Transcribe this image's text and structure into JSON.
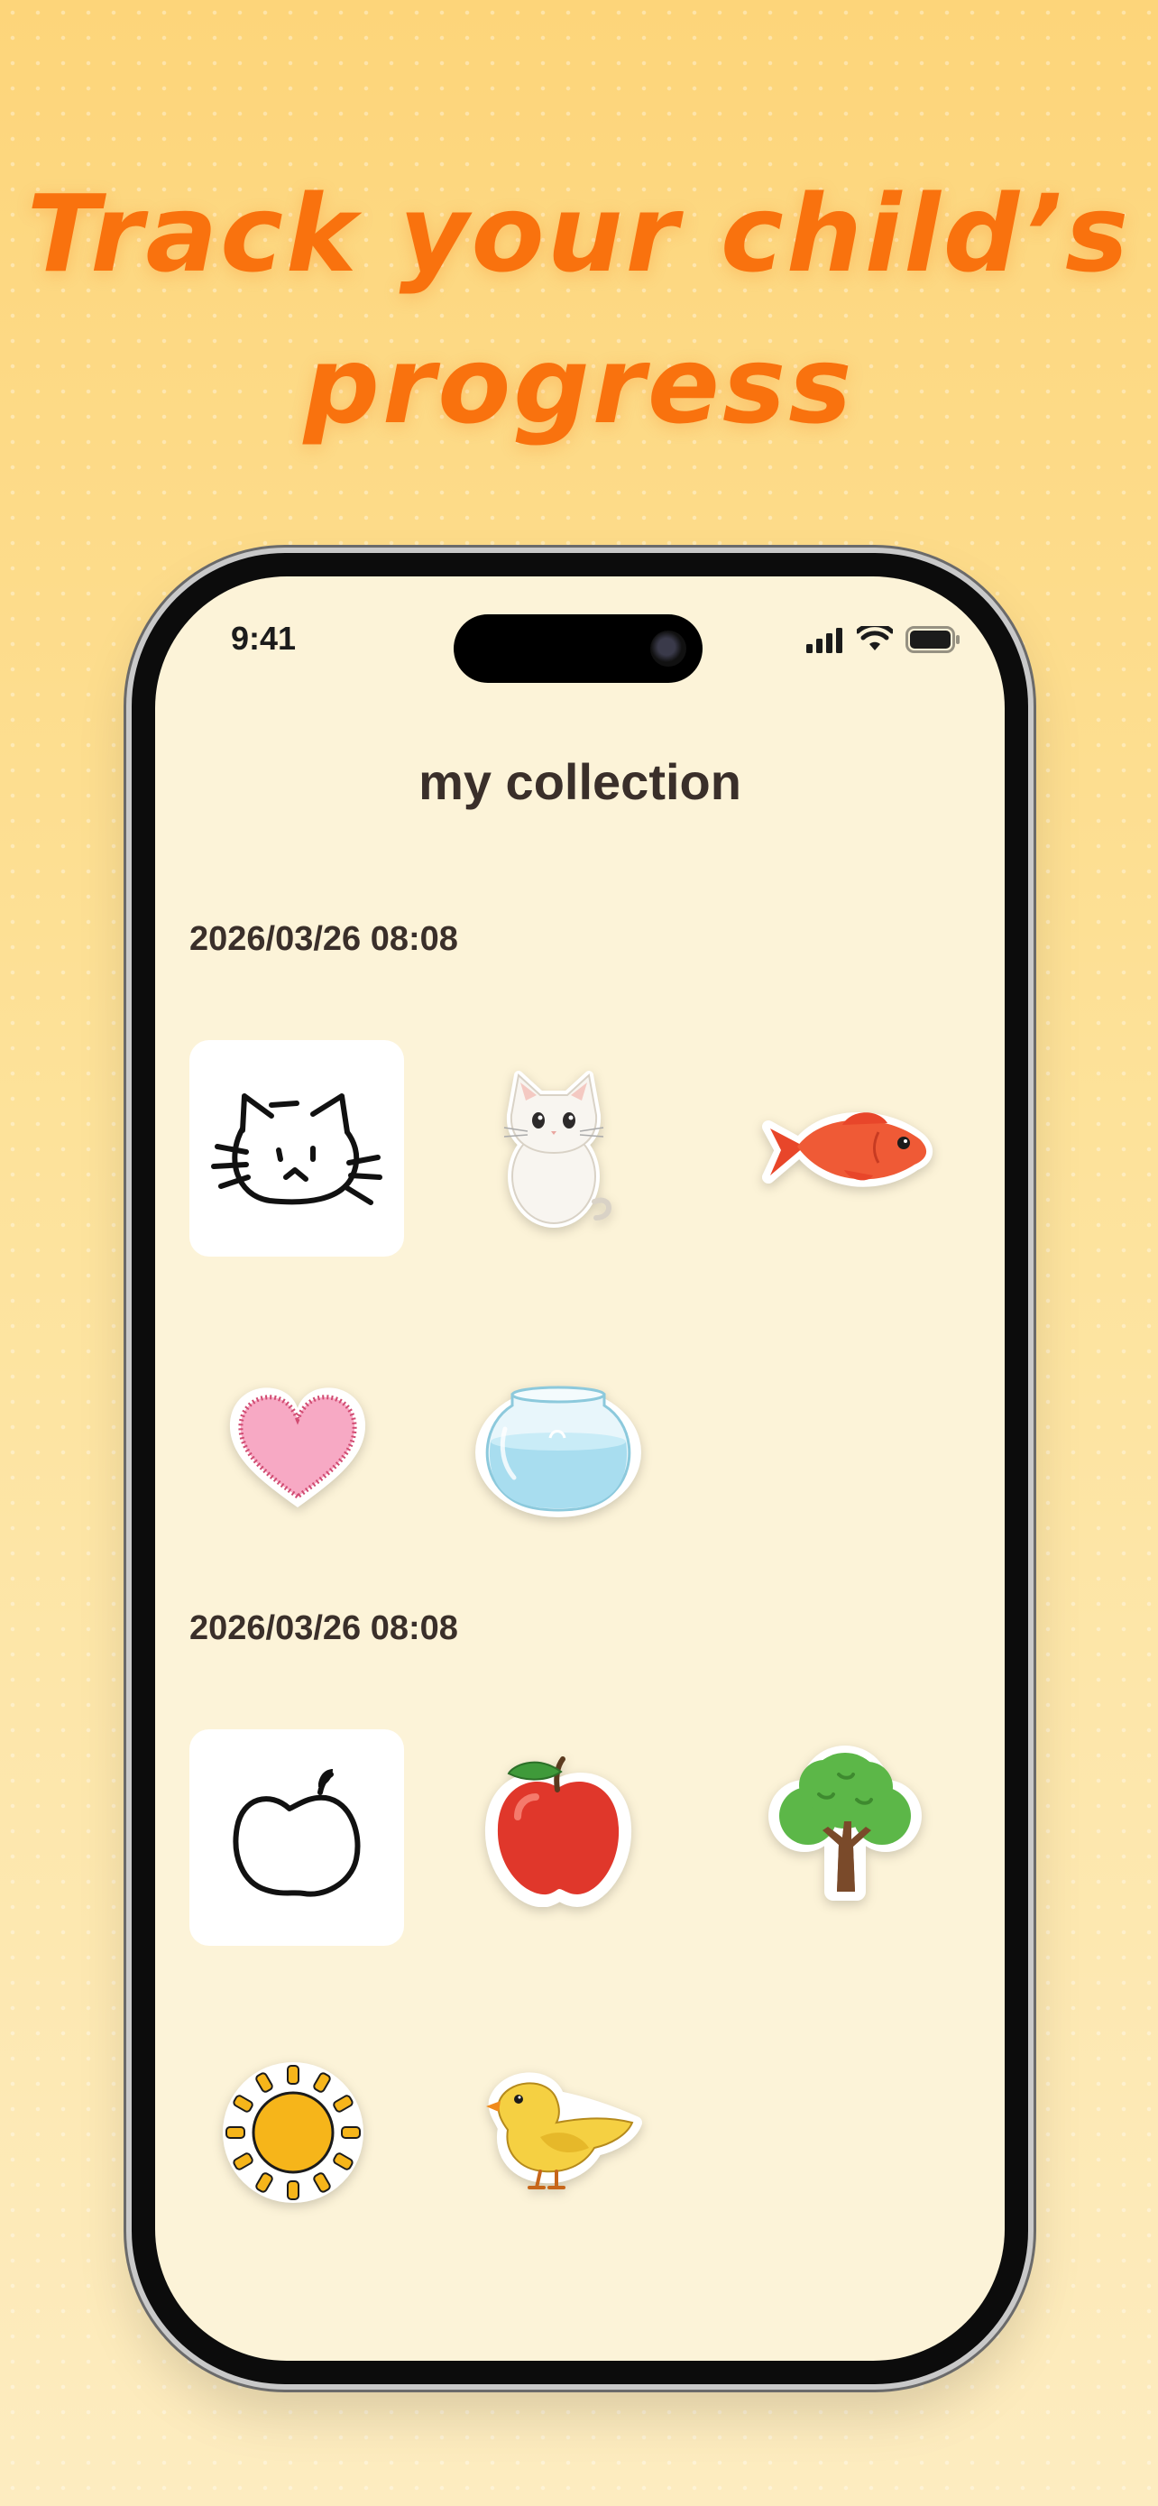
{
  "headline": {
    "line1": "Track your child’s",
    "line2": "progress"
  },
  "status_bar": {
    "time": "9:41",
    "icons": [
      "signal-icon",
      "wifi-icon",
      "battery-icon"
    ]
  },
  "screen": {
    "title": "my collection",
    "groups": [
      {
        "date": "2026/03/26 08:08",
        "drawing": "cat-drawing",
        "stickers": [
          "cat-sticker",
          "fish-sticker",
          "heart-sticker",
          "fishbowl-sticker"
        ]
      },
      {
        "date": "2026/03/26 08:08",
        "drawing": "apple-drawing",
        "stickers": [
          "apple-sticker",
          "tree-sticker",
          "sun-sticker",
          "bird-sticker"
        ]
      }
    ]
  },
  "colors": {
    "headline": "#f9720e",
    "screen_bg": "#fcf3d8",
    "text": "#3a2f2a"
  }
}
